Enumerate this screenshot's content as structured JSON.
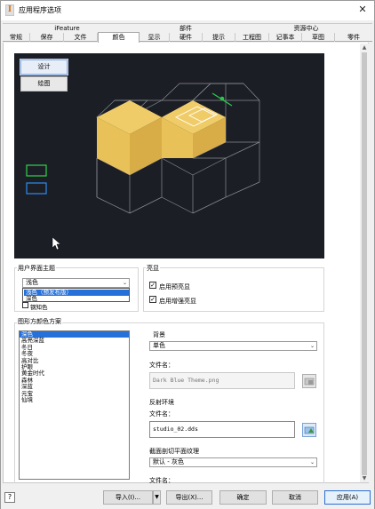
{
  "window": {
    "title": "应用程序选项",
    "close_glyph": "✕"
  },
  "tab_groups": [
    "iFeature",
    "部件",
    "资源中心"
  ],
  "tabs": [
    "常规",
    "保存",
    "文件",
    "颜色",
    "显示",
    "硬件",
    "提示",
    "工程图",
    "记事本",
    "草图",
    "零件"
  ],
  "active_tab": "颜色",
  "preview": {
    "design_button": "设计",
    "draw_button": "绘图",
    "background_color": "#1c1e26",
    "face_color": "#e9c159"
  },
  "ui_theme": {
    "group_label": "用户界面主题",
    "selected": "浅色",
    "options": [
      "浅色（预发布版）",
      "深色"
    ],
    "hidden_checkbox_label": "钢知色"
  },
  "highlight": {
    "group_label": "亮显",
    "checkboxes": [
      {
        "label": "启用预亮显",
        "checked": true
      },
      {
        "label": "启用增强亮显",
        "checked": true
      }
    ]
  },
  "color_scheme": {
    "group_label": "图形方颜色方案",
    "items": [
      "深色",
      "高亮深蓝",
      "冬日",
      "冬夜",
      "高对比",
      "护眼",
      "黄金时代",
      "森林",
      "深蓝",
      "元宝",
      "仙境"
    ],
    "selected_index": 0
  },
  "background": {
    "label": "背景",
    "value": "单色",
    "file_label": "文件名：",
    "file_value": "Dark Blue Theme.png"
  },
  "reflection": {
    "label": "反射环境",
    "file_label": "文件名：",
    "file_value": "studio_02.dds"
  },
  "section_plane": {
    "label": "截面剖切平面纹理",
    "value": "默认 - 灰色",
    "file_label": "文件名："
  },
  "buttons": {
    "import": "导入(I)...",
    "export": "导出(X)...",
    "ok": "确定",
    "cancel": "取消",
    "apply": "应用(A)"
  }
}
